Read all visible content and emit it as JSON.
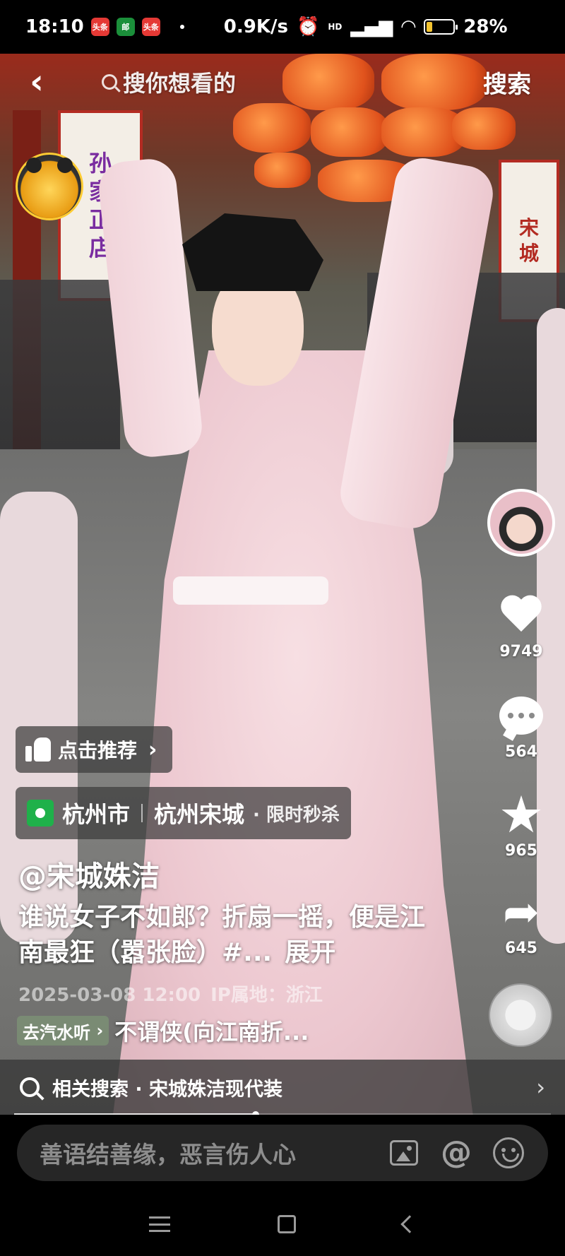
{
  "status_bar": {
    "time": "18:10",
    "app_badges": [
      "头条",
      "邮",
      "头条"
    ],
    "network_speed": "0.9K/s",
    "signal_label": "HD",
    "battery_percent": "28%",
    "battery_level": 0.28
  },
  "top": {
    "search_placeholder": "搜你想看的",
    "search_button": "搜索"
  },
  "background_signs": {
    "shop_banner": [
      "孙",
      "家",
      "正",
      "店"
    ],
    "right_banner": [
      "宋",
      "城"
    ]
  },
  "rail": {
    "likes": "9749",
    "comments": "564",
    "favorites": "965",
    "shares": "645"
  },
  "overlay": {
    "recommend_label": "点击推荐",
    "location_city": "杭州市",
    "location_place": "杭州宋城",
    "location_extra": "· 限时秒杀",
    "author": "@宋城姝洁",
    "description": "谁说女子不如郎？折扇一摇，便是江南最狂（嚣张脸）#...",
    "expand_label": "展开",
    "date": "2025-03-08 12:00",
    "ip_location": "IP属地：浙江",
    "music_tag": "去汽水听",
    "music_title": "不谓侠(向江南折..."
  },
  "related_search": {
    "label": "相关搜索 · 宋城姝洁现代装"
  },
  "playback": {
    "progress": 0.45
  },
  "comment": {
    "placeholder": "善语结善缘，恶言伤人心"
  },
  "icons": {
    "back": "back-arrow-icon",
    "search": "search-icon",
    "like": "heart-icon",
    "comment": "comment-bubble-icon",
    "favorite": "star-icon",
    "share": "share-arrow-icon",
    "image": "image-icon",
    "mention": "at-icon",
    "emoji": "emoji-icon"
  }
}
